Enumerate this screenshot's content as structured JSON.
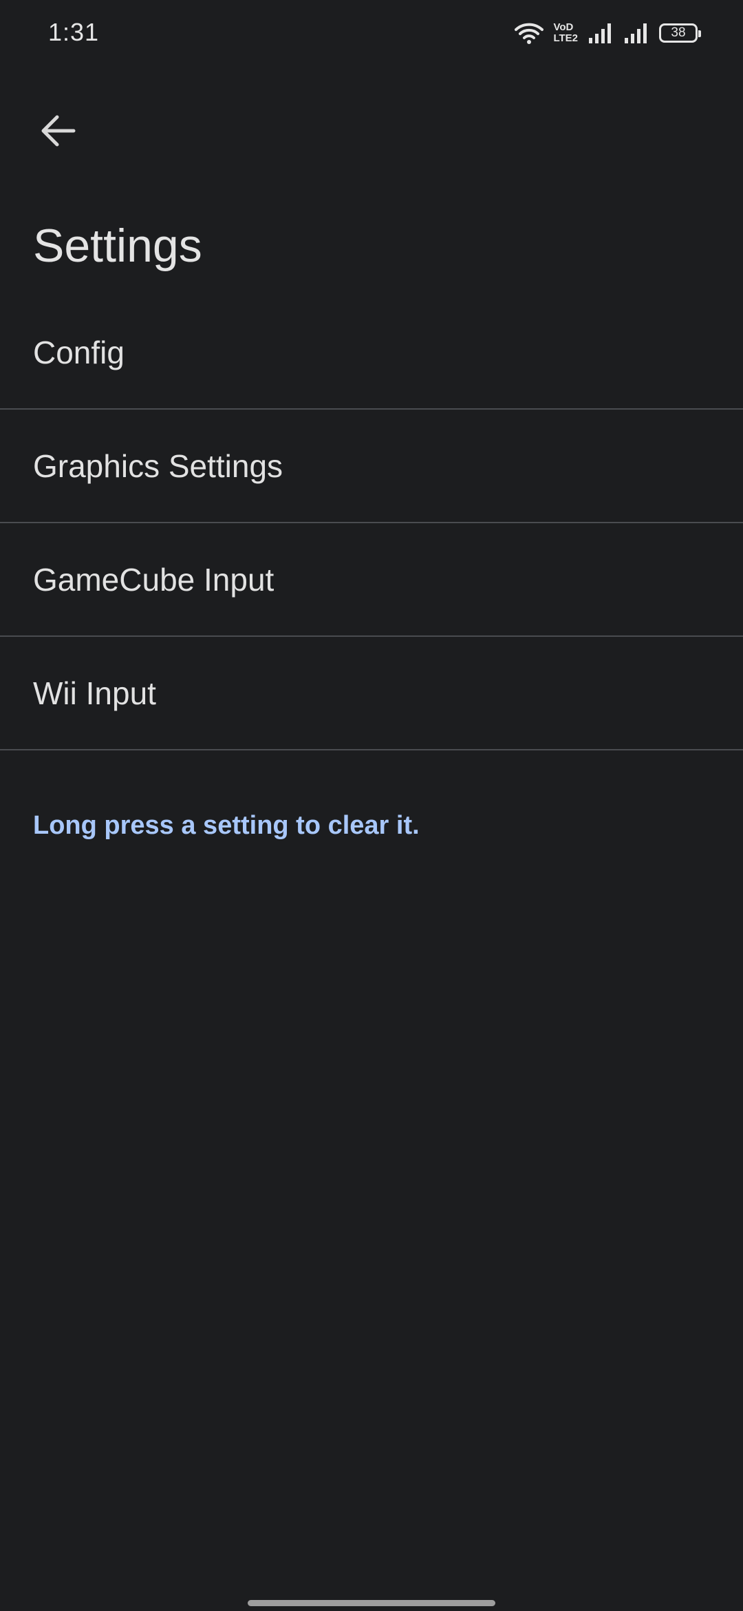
{
  "status_bar": {
    "time": "1:31",
    "network_label_top": "VoD",
    "network_label_bottom": "LTE2",
    "battery_level": "38",
    "icons": [
      "wifi-icon",
      "volte-icon",
      "signal-icon",
      "signal-icon",
      "battery-icon"
    ]
  },
  "header": {
    "back_icon": "arrow-left-icon",
    "title": "Settings"
  },
  "settings": {
    "items": [
      {
        "label": "Config"
      },
      {
        "label": "Graphics Settings"
      },
      {
        "label": "GameCube Input"
      },
      {
        "label": "Wii Input"
      }
    ]
  },
  "hint": "Long press a setting to clear it.",
  "colors": {
    "background": "#1c1d1f",
    "text": "#e2e2e2",
    "divider": "#4a4c50",
    "accent": "#a8c7fa"
  }
}
